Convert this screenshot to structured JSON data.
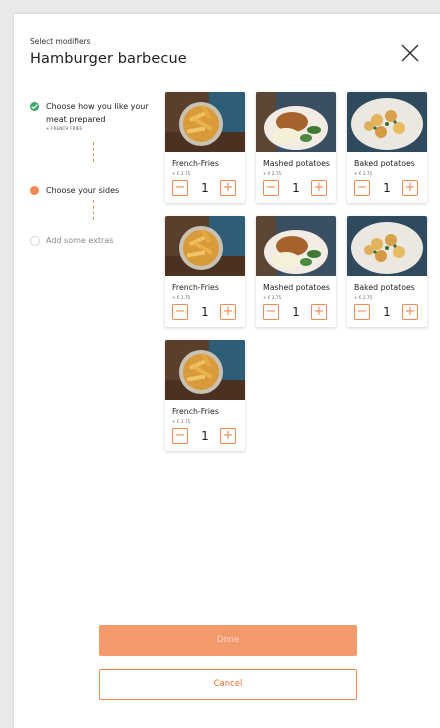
{
  "header": {
    "subtitle": "Select modifiers",
    "title": "Hamburger barbecue"
  },
  "steps": [
    {
      "label": "Choose how you like your meat prepared",
      "note": "+ FRENCH FRIES",
      "status": "done"
    },
    {
      "label": "Choose your sides",
      "status": "active"
    },
    {
      "label": "Add some extras",
      "status": "pending"
    }
  ],
  "items": [
    {
      "name": "French-Fries",
      "price": "+ € 2.75",
      "qty": "1",
      "image": "fries-icon"
    },
    {
      "name": "Mashed potatoes",
      "price": "+ € 2.75",
      "qty": "1",
      "image": "mashed-potatoes-icon"
    },
    {
      "name": "Baked potatoes",
      "price": "+ € 2.75",
      "qty": "1",
      "image": "baked-potatoes-icon"
    },
    {
      "name": "French-Fries",
      "price": "+ € 2.75",
      "qty": "1",
      "image": "fries-icon"
    },
    {
      "name": "Mashed potatoes",
      "price": "+ € 2.75",
      "qty": "1",
      "image": "mashed-potatoes-icon"
    },
    {
      "name": "Baked potatoes",
      "price": "+ € 2.75",
      "qty": "1",
      "image": "baked-potatoes-icon"
    },
    {
      "name": "French-Fries",
      "price": "+ € 2.75",
      "qty": "1",
      "image": "fries-icon"
    }
  ],
  "stepper": {
    "minus": "−",
    "plus": "+"
  },
  "actions": {
    "done_label": "Done",
    "cancel_label": "Cancel"
  },
  "colors": {
    "accent": "#ef8a54",
    "success": "#3aa76d",
    "done_button": "#f29a6b"
  }
}
